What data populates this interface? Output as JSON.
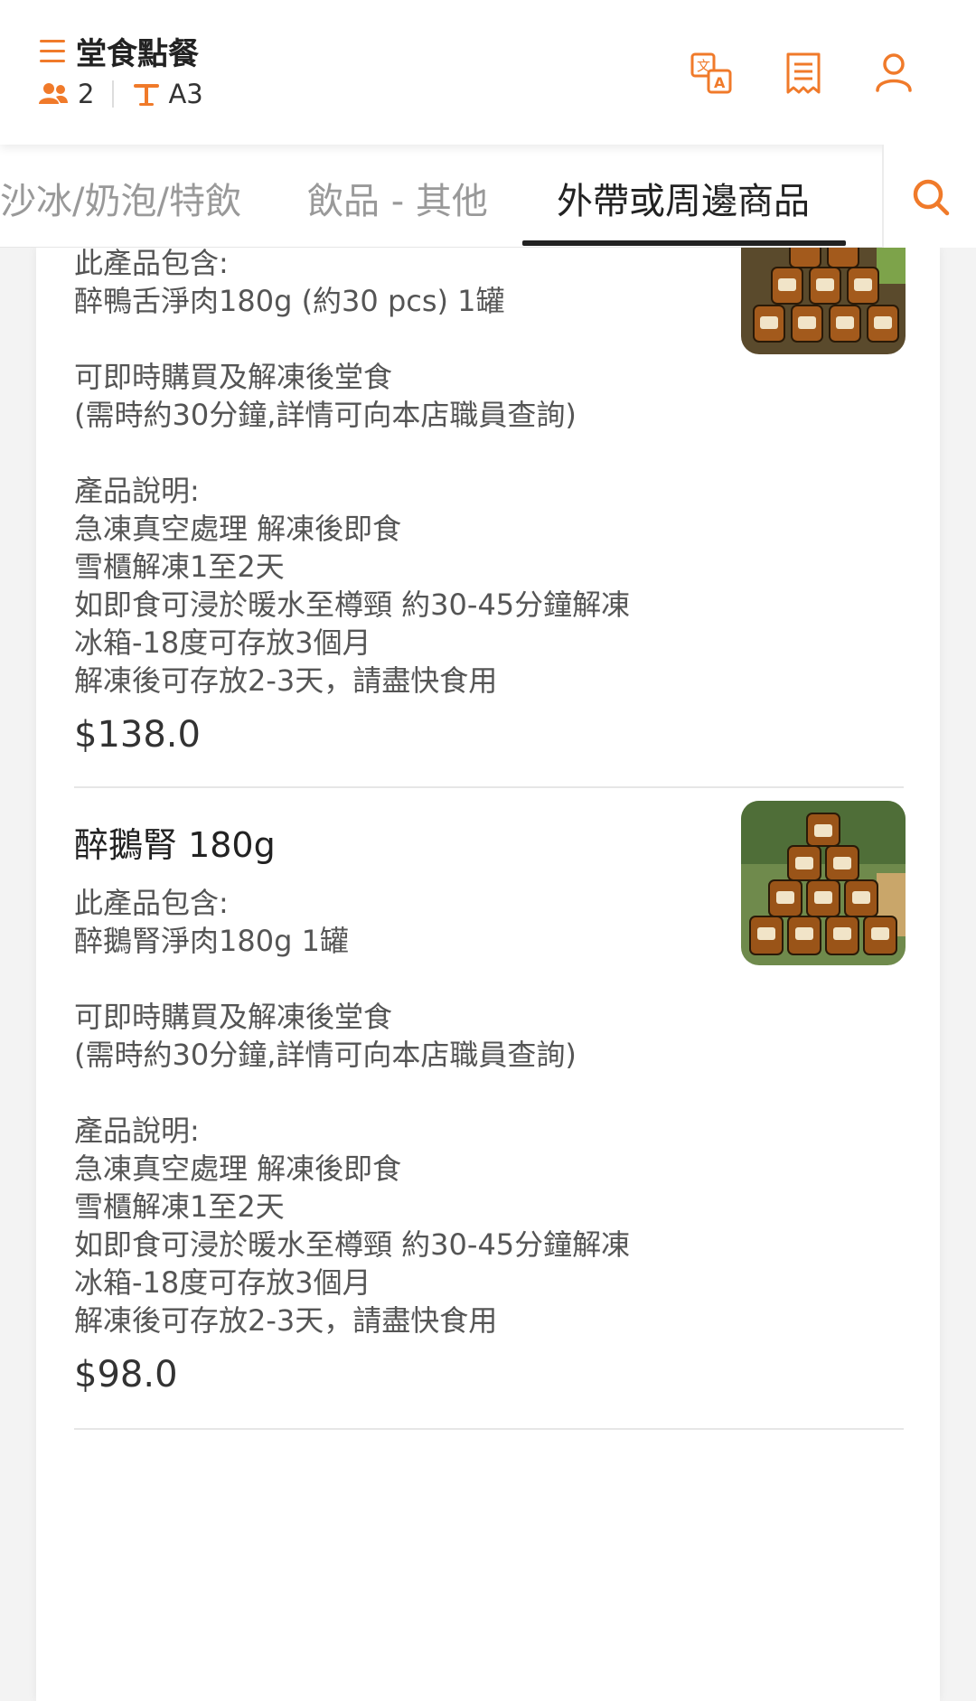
{
  "header": {
    "title": "堂食點餐",
    "guests": "2",
    "table": "A3",
    "icons": [
      "menu-icon",
      "people-icon",
      "table-icon",
      "translate-icon",
      "receipt-icon",
      "user-icon"
    ],
    "accent_color": "#f07a2a"
  },
  "tabs": [
    {
      "label": "沙冰/奶泡/特飲",
      "active": false
    },
    {
      "label": "飲品 - 其他",
      "active": false
    },
    {
      "label": "外帶或周邊商品",
      "active": true
    }
  ],
  "products": [
    {
      "lines": [
        "此產品包含:",
        "醉鴨舌淨肉180g (約30 pcs) 1罐",
        "",
        "可即時購買及解凍後堂食",
        "(需時約30分鐘,詳情可向本店職員查詢)",
        "",
        "產品說明:",
        "急凍真空處理 解凍後即食",
        "雪櫃解凍1至2天",
        "如即食可浸於暖水至樽頸 約30-45分鐘解凍",
        "冰箱-18度可存放3個月",
        "解凍後可存放2-3天，請盡快食用"
      ],
      "price": "$138.0"
    },
    {
      "name": "醉鵝腎 180g",
      "lines": [
        "此產品包含:",
        "醉鵝腎淨肉180g  1罐",
        "",
        "可即時購買及解凍後堂食",
        "(需時約30分鐘,詳情可向本店職員查詢)",
        "",
        "產品說明:",
        "急凍真空處理 解凍後即食",
        "雪櫃解凍1至2天",
        "如即食可浸於暖水至樽頸 約30-45分鐘解凍",
        "冰箱-18度可存放3個月",
        "解凍後可存放2-3天，請盡快食用"
      ],
      "price": "$98.0"
    }
  ]
}
